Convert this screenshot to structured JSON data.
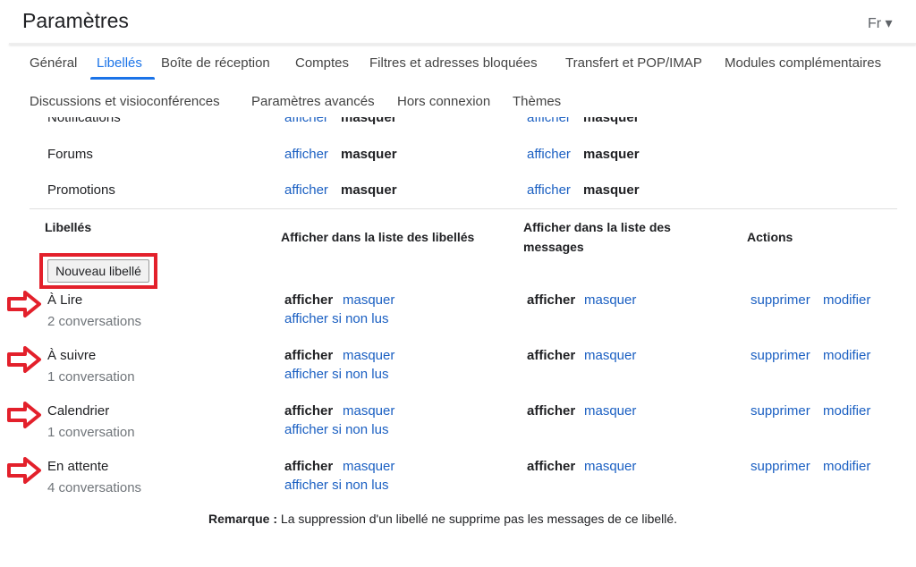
{
  "header": {
    "title": "Paramètres",
    "lang": "Fr ▾"
  },
  "tabs": [
    "Général",
    "Libellés",
    "Boîte de réception",
    "Comptes",
    "Filtres et adresses bloquées",
    "Transfert et POP/IMAP",
    "Modules complémentaires",
    "Discussions et visioconférences",
    "Paramètres avancés",
    "Hors connexion",
    "Thèmes"
  ],
  "active_tab": "Libellés",
  "categories": [
    {
      "name": "Notifications",
      "show": "afficher",
      "hide": "masquer"
    },
    {
      "name": "Forums",
      "show": "afficher",
      "hide": "masquer"
    },
    {
      "name": "Promotions",
      "show": "afficher",
      "hide": "masquer"
    }
  ],
  "labels_header": {
    "col1": "Libellés",
    "col2": "Afficher dans la liste des libellés",
    "col3a": "Afficher dans la liste des",
    "col3b": "messages",
    "col4": "Actions"
  },
  "new_label_button": "Nouveau libellé",
  "labels": [
    {
      "name": "À Lire",
      "count": "2 conversations"
    },
    {
      "name": "À suivre",
      "count": "1 conversation"
    },
    {
      "name": "Calendrier",
      "count": "1 conversation"
    },
    {
      "name": "En attente",
      "count": "4 conversations"
    }
  ],
  "actions": {
    "show": "afficher",
    "hide": "masquer",
    "show_unread": "afficher si non lus",
    "delete": "supprimer",
    "edit": "modifier"
  },
  "note": {
    "bold": "Remarque :",
    "text": " La suppression d'un libellé ne supprime pas les messages de ce libellé."
  },
  "colors": {
    "accent": "#1a73e8",
    "link": "#1a5fc2",
    "highlight": "#e3202b"
  }
}
